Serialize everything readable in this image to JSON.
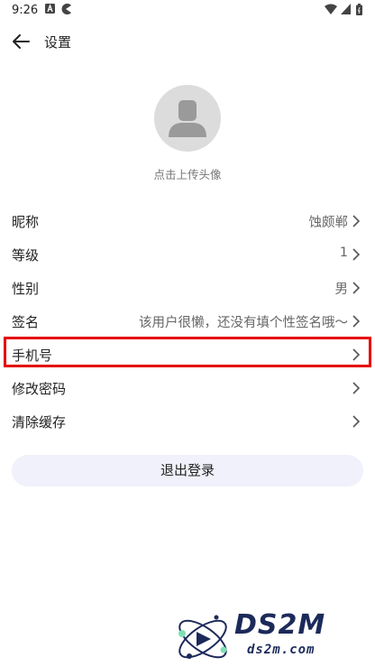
{
  "status_bar": {
    "time": "9:26"
  },
  "header": {
    "title": "设置"
  },
  "avatar": {
    "upload_label": "点击上传头像"
  },
  "rows": [
    {
      "label": "昵称",
      "value": "蚀颇郸"
    },
    {
      "label": "等级",
      "value": "1"
    },
    {
      "label": "性别",
      "value": "男"
    },
    {
      "label": "签名",
      "value": "该用户很懒，还没有填个性签名哦～"
    },
    {
      "label": "手机号",
      "value": ""
    },
    {
      "label": "修改密码",
      "value": ""
    },
    {
      "label": "清除缓存",
      "value": ""
    }
  ],
  "logout_label": "退出登录",
  "watermark": {
    "logo_text": "DS2M",
    "domain_text": "ds2m.com"
  },
  "colors": {
    "highlight": "#e50000",
    "logout_bg": "#f0f1fa",
    "avatar_bg": "#dcdcdc"
  }
}
